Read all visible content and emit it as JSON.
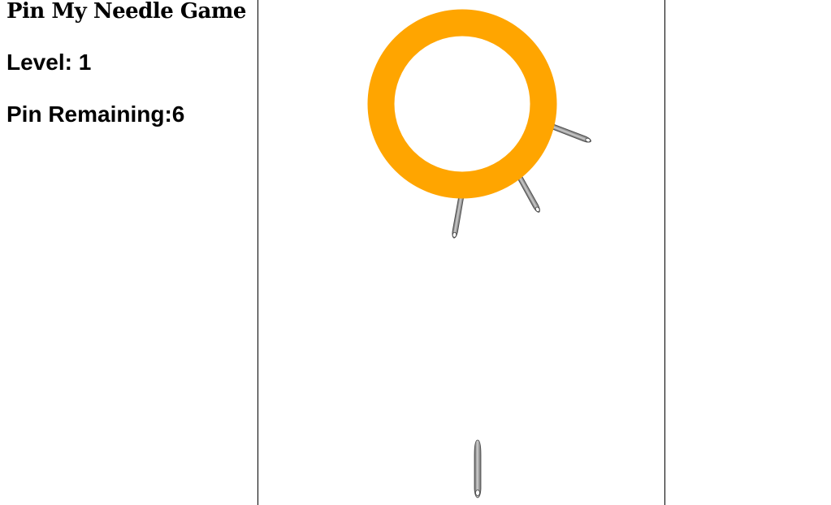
{
  "title": "Pin My Needle Game",
  "level": {
    "label": "Level: ",
    "value": "1"
  },
  "pins_remaining": {
    "label": "Pin Remaining:",
    "value": "6"
  },
  "colors": {
    "ring": "#FFA500",
    "pin_dark": "#6e6e6e",
    "pin_light": "#c8c8c8",
    "border": "#000000"
  },
  "game": {
    "stuck_pins_count": 3,
    "ready_pins_count": 1
  }
}
